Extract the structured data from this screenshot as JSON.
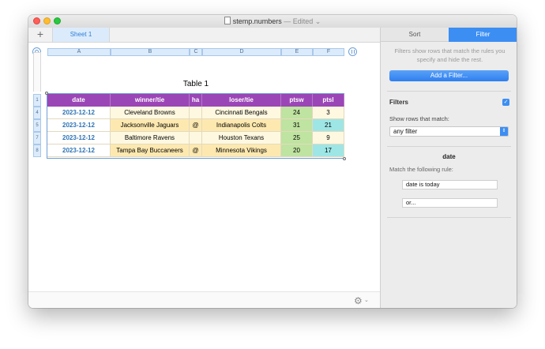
{
  "window": {
    "filename": "stemp.numbers",
    "status": "— Edited ⌄"
  },
  "tabbar": {
    "add_label": "+",
    "sheet_tab": "Sheet 1"
  },
  "columns": [
    "A",
    "B",
    "C",
    "D",
    "E",
    "F"
  ],
  "table": {
    "title": "Table 1",
    "headers": [
      "date",
      "winner/tie",
      "ha",
      "loser/tie",
      "ptsw",
      "ptsl"
    ],
    "row_numbers": [
      "1",
      "4",
      "5",
      "7",
      "8"
    ],
    "rows": [
      {
        "date": "2023-12-12",
        "winner": "Cleveland Browns",
        "ha": "",
        "loser": "Cincinnati Bengals",
        "ptsw": "24",
        "ptsl": "3"
      },
      {
        "date": "2023-12-12",
        "winner": "Jacksonville Jaguars",
        "ha": "@",
        "loser": "Indianapolis Colts",
        "ptsw": "31",
        "ptsl": "21"
      },
      {
        "date": "2023-12-12",
        "winner": "Baltimore Ravens",
        "ha": "",
        "loser": "Houston Texans",
        "ptsw": "25",
        "ptsl": "9"
      },
      {
        "date": "2023-12-12",
        "winner": "Tampa Bay Buccaneers",
        "ha": "@",
        "loser": "Minnesota Vikings",
        "ptsw": "20",
        "ptsl": "17"
      }
    ]
  },
  "colors": {
    "header_bg": "#9b46b6",
    "date_text": "#2f74b5",
    "cream": "#fef8e0",
    "yellow": "#fde9b0",
    "green": "#bfe3a0",
    "cyan": "#9ee6e6",
    "accent": "#3c8ef3"
  },
  "inspector": {
    "tab_sort": "Sort",
    "tab_filter": "Filter",
    "hint": "Filters show rows that match the rules you specify and hide the rest.",
    "add_filter": "Add a Filter...",
    "filters_label": "Filters",
    "filters_checked": "✓",
    "show_rows_label": "Show rows that match:",
    "match_select": "any filter",
    "rule_column": "date",
    "rule_match_label": "Match the following rule:",
    "rule_1": "date is today",
    "rule_2": "or..."
  },
  "status": {
    "gear": "⚙",
    "gear_chevron": "⌄"
  }
}
